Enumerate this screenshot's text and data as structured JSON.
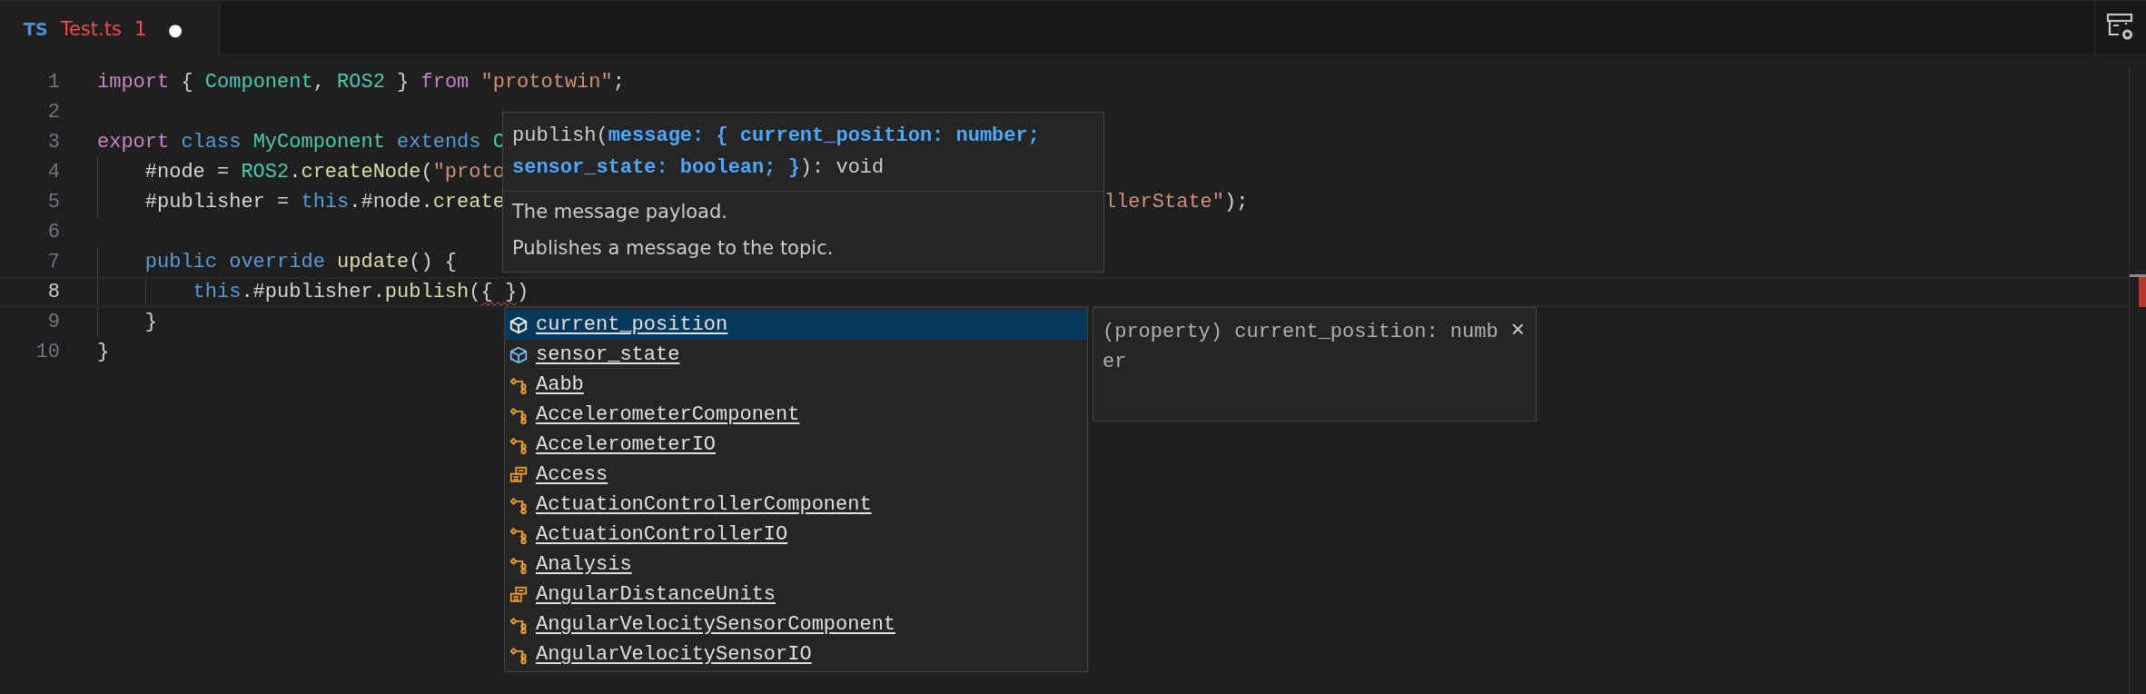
{
  "tabs": [
    {
      "language": "TS",
      "filename": "Test.ts",
      "problems": "1",
      "modified_mark": "●",
      "selected": true
    }
  ],
  "editor": {
    "lines": [
      {
        "number": "1",
        "current": false,
        "segments": [
          [
            {
              "text": "import",
              "kind": "keyword"
            },
            {
              "text": " { ",
              "kind": "plain"
            },
            {
              "text": "Component",
              "kind": "type"
            },
            {
              "text": ", ",
              "kind": "plain"
            },
            {
              "text": "ROS2",
              "kind": "type"
            },
            {
              "text": " } ",
              "kind": "plain"
            },
            {
              "text": "from",
              "kind": "keyword"
            },
            {
              "text": " \"prototwin\"",
              "kind": "string"
            },
            {
              "text": ";",
              "kind": "plain"
            }
          ]
        ]
      },
      {
        "number": "2",
        "current": false
      },
      {
        "number": "3",
        "current": false,
        "segments": [
          [
            {
              "text": "export",
              "kind": "keyword"
            },
            {
              "text": " class",
              "kind": "storage"
            },
            {
              "text": " MyComponent",
              "kind": "type"
            },
            {
              "text": " extends",
              "kind": "storage"
            },
            {
              "text": " C",
              "kind": "type"
            }
          ]
        ]
      },
      {
        "number": "4",
        "current": false,
        "segments": [
          [
            {
              "text": "    #node = ",
              "kind": "plain"
            },
            {
              "text": "ROS2",
              "kind": "type"
            },
            {
              "text": ".",
              "kind": "plain"
            },
            {
              "text": "createNode",
              "kind": "function"
            },
            {
              "text": "(",
              "kind": "plain"
            },
            {
              "text": "\"proto",
              "kind": "string"
            }
          ]
        ]
      },
      {
        "number": "5",
        "current": false,
        "segments": [
          [
            {
              "text": "    #publisher = ",
              "kind": "plain"
            },
            {
              "text": "this",
              "kind": "storage"
            },
            {
              "text": ".#node.",
              "kind": "plain"
            },
            {
              "text": "create",
              "kind": "function"
            }
          ],
          [
            {
              "text": "llerState\"",
              "kind": "string"
            },
            {
              "text": ");",
              "kind": "plain"
            }
          ]
        ]
      },
      {
        "number": "6",
        "current": false
      },
      {
        "number": "7",
        "current": false,
        "segments": [
          [
            {
              "text": "    public",
              "kind": "storage"
            },
            {
              "text": " override",
              "kind": "storage"
            },
            {
              "text": " update",
              "kind": "function"
            },
            {
              "text": "() {",
              "kind": "plain"
            }
          ]
        ]
      },
      {
        "number": "8",
        "current": true,
        "segments": [
          [
            {
              "text": "        this",
              "kind": "storage"
            },
            {
              "text": ".#publisher.",
              "kind": "plain"
            },
            {
              "text": "publish",
              "kind": "function"
            },
            {
              "text": "(",
              "kind": "plain"
            },
            {
              "text": "{ }",
              "kind": "plain",
              "error": true
            },
            {
              "text": ")",
              "kind": "plain"
            }
          ]
        ]
      },
      {
        "number": "9",
        "current": false,
        "segments": [
          [
            {
              "text": "    }",
              "kind": "plain"
            }
          ]
        ]
      },
      {
        "number": "10",
        "current": false,
        "segments": [
          [
            {
              "text": "}",
              "kind": "plain"
            }
          ]
        ]
      }
    ]
  },
  "hover": {
    "signature": "publish(**message: { current_position: number; sensor_state: boolean; }**): void",
    "docs": [
      "The message payload.",
      "Publishes a message to the topic."
    ]
  },
  "suggestions": [
    {
      "label": "current_position",
      "kind": "property",
      "selected": true
    },
    {
      "label": "sensor_state",
      "kind": "property",
      "selected": false
    },
    {
      "label": "Aabb",
      "kind": "class",
      "selected": false
    },
    {
      "label": "AccelerometerComponent",
      "kind": "class",
      "selected": false
    },
    {
      "label": "AccelerometerIO",
      "kind": "class",
      "selected": false
    },
    {
      "label": "Access",
      "kind": "enum",
      "selected": false
    },
    {
      "label": "ActuationControllerComponent",
      "kind": "class",
      "selected": false
    },
    {
      "label": "ActuationControllerIO",
      "kind": "class",
      "selected": false
    },
    {
      "label": "Analysis",
      "kind": "class",
      "selected": false
    },
    {
      "label": "AngularDistanceUnits",
      "kind": "enum",
      "selected": false
    },
    {
      "label": "AngularVelocitySensorComponent",
      "kind": "class",
      "selected": false
    },
    {
      "label": "AngularVelocitySensorIO",
      "kind": "class",
      "selected": false
    }
  ],
  "details": {
    "text": "(property) current_position: number",
    "close": "×"
  }
}
